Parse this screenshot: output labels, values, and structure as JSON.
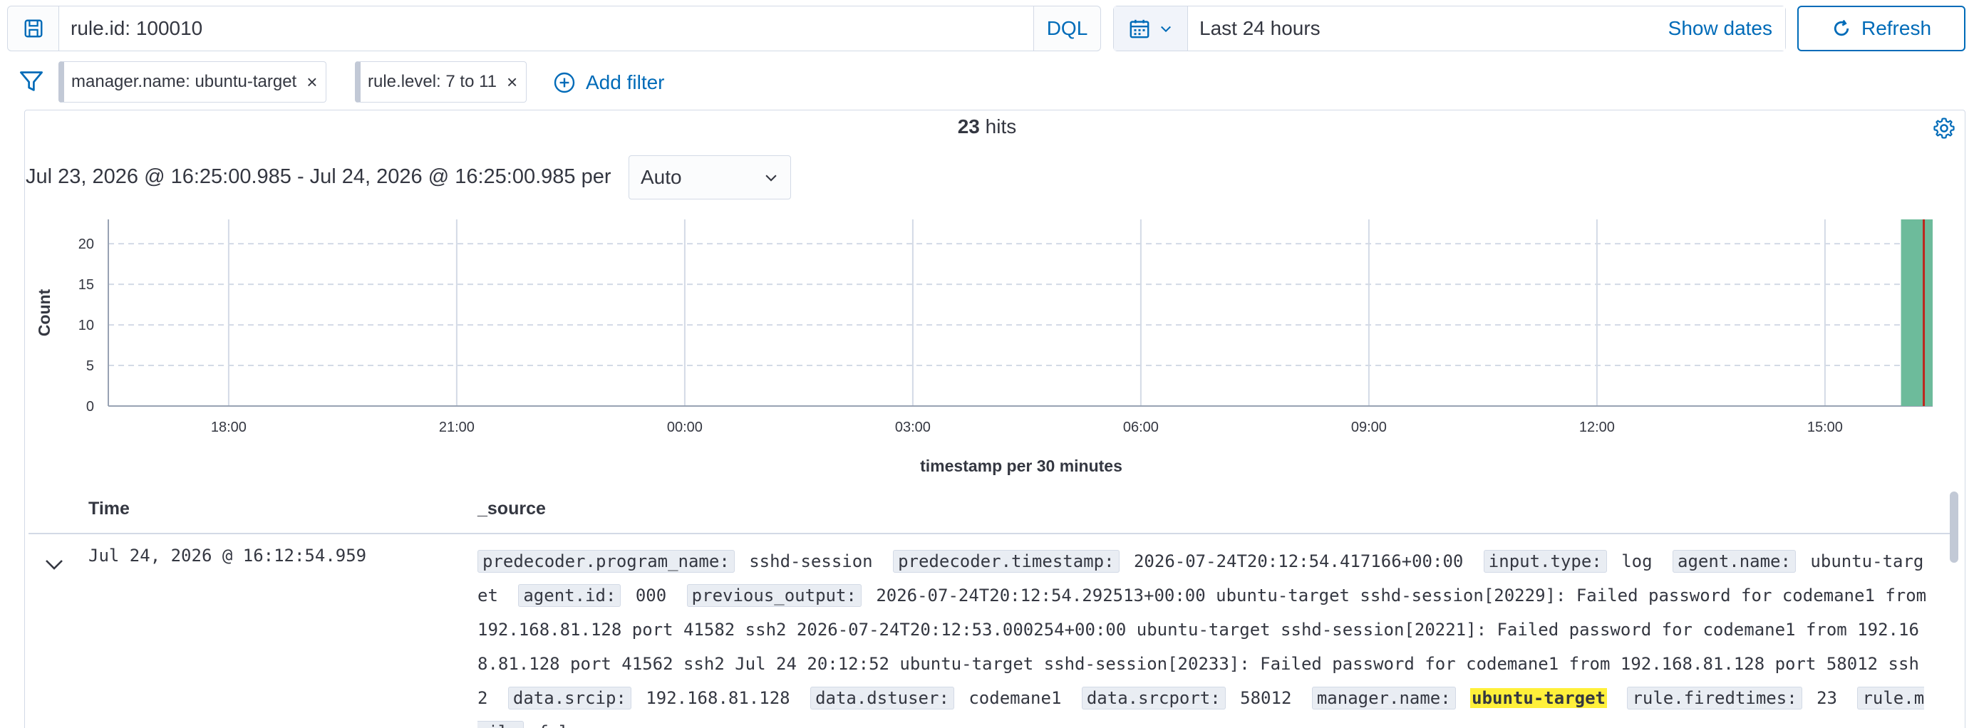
{
  "query_bar": {
    "query": "rule.id: 100010",
    "language": "DQL",
    "date_range": "Last 24 hours",
    "show_dates": "Show dates",
    "refresh": "Refresh"
  },
  "filters": {
    "items": [
      {
        "label": "manager.name: ubuntu-target"
      },
      {
        "label": "rule.level: 7 to 11"
      }
    ],
    "add_filter": "Add filter"
  },
  "results": {
    "hits_count": "23",
    "hits_label": "hits",
    "time_range": "Jul 23, 2026 @ 16:25:00.985 - Jul 24, 2026 @ 16:25:00.985 per",
    "interval": "Auto"
  },
  "chart_data": {
    "type": "bar",
    "xlabel": "timestamp per 30 minutes",
    "ylabel": "Count",
    "ylim": [
      0,
      23
    ],
    "yticks": [
      0,
      5,
      10,
      15,
      20
    ],
    "x_tick_labels": [
      "18:00",
      "21:00",
      "00:00",
      "03:00",
      "06:00",
      "09:00",
      "12:00",
      "15:00"
    ],
    "x_range_hours": [
      16.4167,
      40.4167
    ],
    "bars": [
      {
        "start_hour": 40.0,
        "end_hour": 40.4167,
        "value": 23
      }
    ],
    "now_marker_hour": 40.3,
    "grid": true,
    "bar_color": "#6dbb9b",
    "marker_color": "#bd271e"
  },
  "table": {
    "columns": [
      "Time",
      "_source"
    ],
    "rows": [
      {
        "time": "Jul 24, 2026 @ 16:12:54.959",
        "fields": [
          {
            "key": "predecoder.program_name:",
            "value": "sshd-session"
          },
          {
            "key": "predecoder.timestamp:",
            "value": "2026-07-24T20:12:54.417166+00:00"
          },
          {
            "key": "input.type:",
            "value": "log"
          },
          {
            "key": "agent.name:",
            "value": "ubuntu-target"
          },
          {
            "key": "agent.id:",
            "value": "000"
          },
          {
            "key": "previous_output:",
            "value": "2026-07-24T20:12:54.292513+00:00 ubuntu-target sshd-session[20229]: Failed password for codemane1 from 192.168.81.128 port 41582 ssh2 2026-07-24T20:12:53.000254+00:00 ubuntu-target sshd-session[20221]: Failed password for codemane1 from 192.168.81.128 port 41562 ssh2 Jul 24 20:12:52 ubuntu-target sshd-session[20233]: Failed password for codemane1 from 192.168.81.128 port 58012 ssh2"
          },
          {
            "key": "data.srcip:",
            "value": "192.168.81.128"
          },
          {
            "key": "data.dstuser:",
            "value": "codemane1"
          },
          {
            "key": "data.srcport:",
            "value": "58012"
          },
          {
            "key": "manager.name:",
            "value": "ubuntu-target",
            "highlight": true
          },
          {
            "key": "rule.firedtimes:",
            "value": "23"
          },
          {
            "key": "rule.mail:",
            "value": "false"
          }
        ]
      }
    ]
  },
  "colors": {
    "accent": "#006bb8",
    "border": "#d3dae6",
    "highlight": "#fff03a"
  }
}
